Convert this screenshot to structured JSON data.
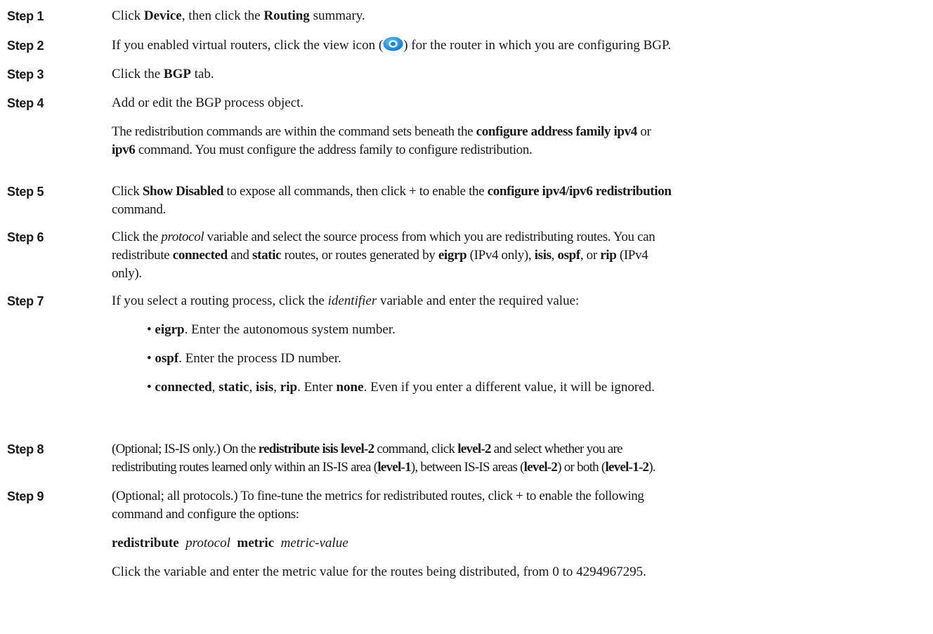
{
  "steps": [
    {
      "label": "Step 1",
      "paragraphs": [
        [
          {
            "t": "Click "
          },
          {
            "t": "Device",
            "b": true
          },
          {
            "t": ", then click the "
          },
          {
            "t": "Routing",
            "b": true
          },
          {
            "t": " summary."
          }
        ]
      ]
    },
    {
      "label": "Step 2",
      "paragraphs": [
        [
          {
            "t": "If you enabled virtual routers, click the view icon ("
          },
          {
            "icon": "view-icon"
          },
          {
            "t": ") for the router in which you are configuring BGP."
          }
        ]
      ]
    },
    {
      "label": "Step 3",
      "paragraphs": [
        [
          {
            "t": "Click the "
          },
          {
            "t": "BGP",
            "b": true
          },
          {
            "t": " tab."
          }
        ]
      ]
    },
    {
      "label": "Step 4",
      "paragraphs": [
        [
          {
            "t": "Add or edit the BGP process object."
          }
        ],
        [
          {
            "t": "The redistribution commands are within the command sets beneath the "
          },
          {
            "t": "configure address family ipv4",
            "b": true
          },
          {
            "t": " or"
          },
          {
            "br": true
          },
          {
            "t": "ipv6",
            "b": true
          },
          {
            "t": " command. You must configure the address family to configure redistribution."
          }
        ]
      ]
    },
    {
      "label": "Step 5",
      "paragraphs": [
        [
          {
            "t": "Click "
          },
          {
            "t": "Show Disabled",
            "b": true
          },
          {
            "t": " to expose all commands, then click + to enable the "
          },
          {
            "t": "configure ipv4/ipv6 redistribution",
            "b": true
          },
          {
            "br": true
          },
          {
            "t": "command."
          }
        ]
      ]
    },
    {
      "label": "Step 6",
      "paragraphs": [
        [
          {
            "t": "Click the "
          },
          {
            "t": "protocol",
            "i": true
          },
          {
            "t": " variable and select the source process from which you are redistributing routes. You can"
          },
          {
            "br": true
          },
          {
            "t": "redistribute "
          },
          {
            "t": "connected",
            "b": true
          },
          {
            "t": " and "
          },
          {
            "t": "static",
            "b": true
          },
          {
            "t": " routes, or routes generated by "
          },
          {
            "t": "eigrp",
            "b": true
          },
          {
            "t": " (IPv4 only), "
          },
          {
            "t": "isis",
            "b": true
          },
          {
            "t": ", "
          },
          {
            "t": "ospf",
            "b": true
          },
          {
            "t": ", or "
          },
          {
            "t": "rip",
            "b": true
          },
          {
            "t": " (IPv4"
          },
          {
            "br": true
          },
          {
            "t": "only)."
          }
        ]
      ]
    },
    {
      "label": "Step 7",
      "paragraphs": [
        [
          {
            "t": "If you select a routing process, click the "
          },
          {
            "t": "identifier",
            "i": true
          },
          {
            "t": " variable and enter the required value:"
          }
        ],
        [
          {
            "t": "• "
          },
          {
            "t": "eigrp",
            "b": true
          },
          {
            "t": ". Enter the autonomous system number."
          }
        ],
        [
          {
            "t": "• "
          },
          {
            "t": "ospf",
            "b": true
          },
          {
            "t": ". Enter the process ID number."
          }
        ],
        [
          {
            "t": "• "
          },
          {
            "t": "connected",
            "b": true
          },
          {
            "t": ", "
          },
          {
            "t": "static",
            "b": true
          },
          {
            "t": ", "
          },
          {
            "t": "isis",
            "b": true
          },
          {
            "t": ", "
          },
          {
            "t": "rip",
            "b": true
          },
          {
            "t": ". Enter "
          },
          {
            "t": "none",
            "b": true
          },
          {
            "t": ". Even if you enter a different value, it will be ignored."
          }
        ]
      ]
    },
    {
      "label": "Step 8",
      "paragraphs": [
        [
          {
            "t": "(Optional; IS-IS only.) On the "
          },
          {
            "t": "redistribute isis level-2",
            "b": true
          },
          {
            "t": " command, click "
          },
          {
            "t": "level-2",
            "b": true
          },
          {
            "t": " and select whether you are"
          },
          {
            "br": true
          },
          {
            "t": "redistributing routes learned only within an IS-IS area ("
          },
          {
            "t": "level-1",
            "b": true
          },
          {
            "t": "), between IS-IS areas ("
          },
          {
            "t": "level-2",
            "b": true
          },
          {
            "t": ") or both ("
          },
          {
            "t": "level-1-2",
            "b": true
          },
          {
            "t": ")."
          }
        ]
      ]
    },
    {
      "label": "Step 9",
      "paragraphs": [
        [
          {
            "t": "(Optional; all protocols.) To fine-tune the metrics for redistributed routes, click + to enable the following"
          },
          {
            "br": true
          },
          {
            "t": "command and configure the options:"
          }
        ],
        [
          {
            "t": "redistribute",
            "b": true
          },
          {
            "t": "  "
          },
          {
            "t": "protocol",
            "i": true
          },
          {
            "t": "  "
          },
          {
            "t": "metric",
            "b": true
          },
          {
            "t": "  "
          },
          {
            "t": "metric-value",
            "i": true
          }
        ],
        [
          {
            "t": "Click the variable and enter the metric value for the routes being distributed, from 0 to 4294967295."
          }
        ]
      ]
    }
  ]
}
